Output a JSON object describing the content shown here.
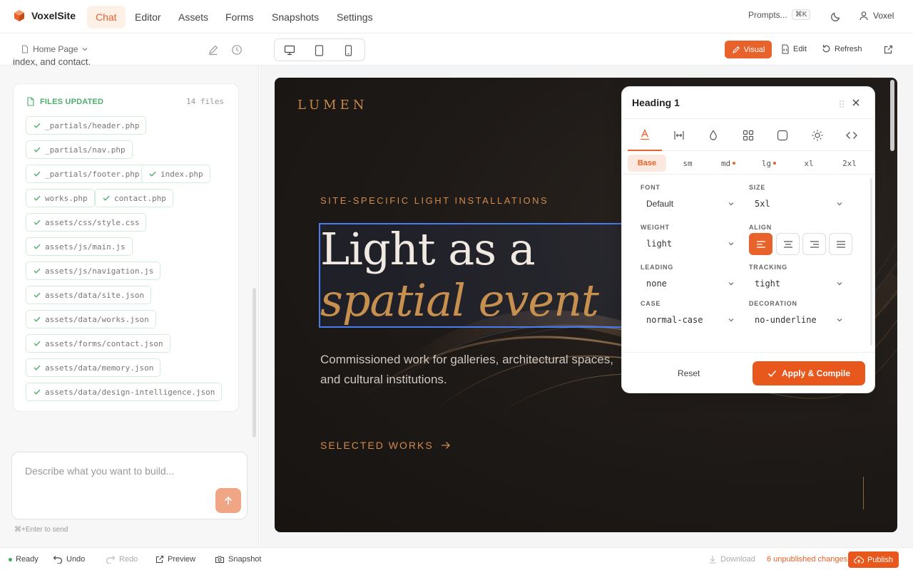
{
  "app": {
    "name": "VoxelSite",
    "accent": "#e8622c"
  },
  "nav": {
    "tabs": [
      {
        "label": "Chat",
        "active": true
      },
      {
        "label": "Editor",
        "active": false
      },
      {
        "label": "Assets",
        "active": false
      },
      {
        "label": "Forms",
        "active": false
      },
      {
        "label": "Snapshots",
        "active": false
      },
      {
        "label": "Settings",
        "active": false
      }
    ],
    "prompts_label": "Prompts...",
    "prompts_shortcut": "⌘K",
    "theme_icon": "moon-icon",
    "user_name": "Voxel"
  },
  "left_panel": {
    "page_selector": "Home Page",
    "truncated_message": "index, and contact.",
    "files": {
      "title": "FILES UPDATED",
      "count": "14 files",
      "items": [
        "_partials/header.php",
        "_partials/nav.php",
        "_partials/footer.php",
        "index.php",
        "works.php",
        "contact.php",
        "assets/css/style.css",
        "assets/js/main.js",
        "assets/js/navigation.js",
        "assets/data/site.json",
        "assets/data/works.json",
        "assets/forms/contact.json",
        "assets/data/memory.json",
        "assets/data/design-intelligence.json"
      ]
    },
    "chat_input_placeholder": "Describe what you want to build...",
    "hint": "⌘+Enter to send"
  },
  "preview": {
    "devices": [
      "desktop-icon",
      "tablet-icon",
      "mobile-icon"
    ],
    "visual_label": "Visual",
    "edit_label": "Edit",
    "refresh_label": "Refresh"
  },
  "site": {
    "logo": "LUMEN",
    "kicker": "SITE-SPECIFIC LIGHT INSTALLATIONS",
    "heading_line1": "Light as a",
    "heading_line2": "spatial event",
    "desc_line1": "Commissioned work for galleries, architectural spaces,",
    "desc_line2": "and cultural institutions.",
    "cta": "SELECTED WORKS",
    "accent": "#d28a4b"
  },
  "style_panel": {
    "title": "Heading 1",
    "tabs": [
      "typography-icon",
      "spacing-icon",
      "color-drop-icon",
      "layout-grid-icon",
      "border-icon",
      "effects-sun-icon",
      "code-icon"
    ],
    "breakpoints": [
      {
        "label": "Base",
        "active": true,
        "modified": false
      },
      {
        "label": "sm",
        "active": false,
        "modified": false
      },
      {
        "label": "md",
        "active": false,
        "modified": true
      },
      {
        "label": "lg",
        "active": false,
        "modified": true
      },
      {
        "label": "xl",
        "active": false,
        "modified": false
      },
      {
        "label": "2xl",
        "active": false,
        "modified": false
      }
    ],
    "fields": {
      "font": {
        "label": "FONT",
        "value": "Default"
      },
      "size": {
        "label": "SIZE",
        "value": "5xl"
      },
      "weight": {
        "label": "WEIGHT",
        "value": "light"
      },
      "align": {
        "label": "ALIGN",
        "value": "left"
      },
      "leading": {
        "label": "LEADING",
        "value": "none"
      },
      "tracking": {
        "label": "TRACKING",
        "value": "tight"
      },
      "case": {
        "label": "CASE",
        "value": "normal-case"
      },
      "decoration": {
        "label": "DECORATION",
        "value": "no-underline"
      }
    },
    "reset_label": "Reset",
    "apply_label": "Apply & Compile"
  },
  "status_bar": {
    "status": "Ready",
    "undo": "Undo",
    "redo": "Redo",
    "preview": "Preview",
    "snapshot": "Snapshot",
    "download": "Download",
    "unpublished": "6 unpublished changes",
    "publish": "Publish"
  }
}
